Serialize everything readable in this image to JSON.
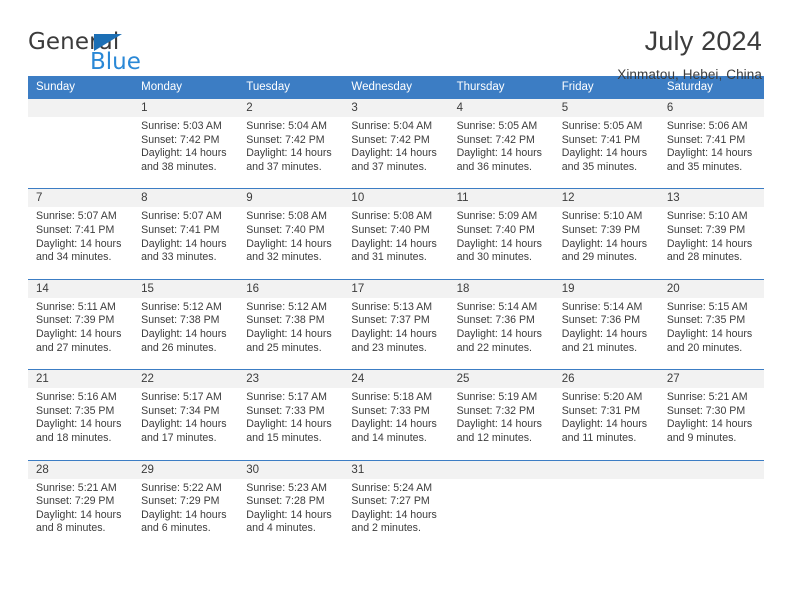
{
  "brand": {
    "name_part1": "General",
    "name_part2": "Blue",
    "accent_color": "#2a88d6",
    "triangle_color": "#1c6fb5"
  },
  "header": {
    "month_title": "July 2024",
    "location": "Xinmatou, Hebei, China"
  },
  "calendar": {
    "header_bg": "#3c7dc4",
    "daynum_bg": "#f2f2f2",
    "weekday_headers": [
      "Sunday",
      "Monday",
      "Tuesday",
      "Wednesday",
      "Thursday",
      "Friday",
      "Saturday"
    ],
    "weeks": [
      [
        {
          "day": "",
          "sunrise": "",
          "sunset": "",
          "daylight1": "",
          "daylight2": ""
        },
        {
          "day": "1",
          "sunrise": "Sunrise: 5:03 AM",
          "sunset": "Sunset: 7:42 PM",
          "daylight1": "Daylight: 14 hours",
          "daylight2": "and 38 minutes."
        },
        {
          "day": "2",
          "sunrise": "Sunrise: 5:04 AM",
          "sunset": "Sunset: 7:42 PM",
          "daylight1": "Daylight: 14 hours",
          "daylight2": "and 37 minutes."
        },
        {
          "day": "3",
          "sunrise": "Sunrise: 5:04 AM",
          "sunset": "Sunset: 7:42 PM",
          "daylight1": "Daylight: 14 hours",
          "daylight2": "and 37 minutes."
        },
        {
          "day": "4",
          "sunrise": "Sunrise: 5:05 AM",
          "sunset": "Sunset: 7:42 PM",
          "daylight1": "Daylight: 14 hours",
          "daylight2": "and 36 minutes."
        },
        {
          "day": "5",
          "sunrise": "Sunrise: 5:05 AM",
          "sunset": "Sunset: 7:41 PM",
          "daylight1": "Daylight: 14 hours",
          "daylight2": "and 35 minutes."
        },
        {
          "day": "6",
          "sunrise": "Sunrise: 5:06 AM",
          "sunset": "Sunset: 7:41 PM",
          "daylight1": "Daylight: 14 hours",
          "daylight2": "and 35 minutes."
        }
      ],
      [
        {
          "day": "7",
          "sunrise": "Sunrise: 5:07 AM",
          "sunset": "Sunset: 7:41 PM",
          "daylight1": "Daylight: 14 hours",
          "daylight2": "and 34 minutes."
        },
        {
          "day": "8",
          "sunrise": "Sunrise: 5:07 AM",
          "sunset": "Sunset: 7:41 PM",
          "daylight1": "Daylight: 14 hours",
          "daylight2": "and 33 minutes."
        },
        {
          "day": "9",
          "sunrise": "Sunrise: 5:08 AM",
          "sunset": "Sunset: 7:40 PM",
          "daylight1": "Daylight: 14 hours",
          "daylight2": "and 32 minutes."
        },
        {
          "day": "10",
          "sunrise": "Sunrise: 5:08 AM",
          "sunset": "Sunset: 7:40 PM",
          "daylight1": "Daylight: 14 hours",
          "daylight2": "and 31 minutes."
        },
        {
          "day": "11",
          "sunrise": "Sunrise: 5:09 AM",
          "sunset": "Sunset: 7:40 PM",
          "daylight1": "Daylight: 14 hours",
          "daylight2": "and 30 minutes."
        },
        {
          "day": "12",
          "sunrise": "Sunrise: 5:10 AM",
          "sunset": "Sunset: 7:39 PM",
          "daylight1": "Daylight: 14 hours",
          "daylight2": "and 29 minutes."
        },
        {
          "day": "13",
          "sunrise": "Sunrise: 5:10 AM",
          "sunset": "Sunset: 7:39 PM",
          "daylight1": "Daylight: 14 hours",
          "daylight2": "and 28 minutes."
        }
      ],
      [
        {
          "day": "14",
          "sunrise": "Sunrise: 5:11 AM",
          "sunset": "Sunset: 7:39 PM",
          "daylight1": "Daylight: 14 hours",
          "daylight2": "and 27 minutes."
        },
        {
          "day": "15",
          "sunrise": "Sunrise: 5:12 AM",
          "sunset": "Sunset: 7:38 PM",
          "daylight1": "Daylight: 14 hours",
          "daylight2": "and 26 minutes."
        },
        {
          "day": "16",
          "sunrise": "Sunrise: 5:12 AM",
          "sunset": "Sunset: 7:38 PM",
          "daylight1": "Daylight: 14 hours",
          "daylight2": "and 25 minutes."
        },
        {
          "day": "17",
          "sunrise": "Sunrise: 5:13 AM",
          "sunset": "Sunset: 7:37 PM",
          "daylight1": "Daylight: 14 hours",
          "daylight2": "and 23 minutes."
        },
        {
          "day": "18",
          "sunrise": "Sunrise: 5:14 AM",
          "sunset": "Sunset: 7:36 PM",
          "daylight1": "Daylight: 14 hours",
          "daylight2": "and 22 minutes."
        },
        {
          "day": "19",
          "sunrise": "Sunrise: 5:14 AM",
          "sunset": "Sunset: 7:36 PM",
          "daylight1": "Daylight: 14 hours",
          "daylight2": "and 21 minutes."
        },
        {
          "day": "20",
          "sunrise": "Sunrise: 5:15 AM",
          "sunset": "Sunset: 7:35 PM",
          "daylight1": "Daylight: 14 hours",
          "daylight2": "and 20 minutes."
        }
      ],
      [
        {
          "day": "21",
          "sunrise": "Sunrise: 5:16 AM",
          "sunset": "Sunset: 7:35 PM",
          "daylight1": "Daylight: 14 hours",
          "daylight2": "and 18 minutes."
        },
        {
          "day": "22",
          "sunrise": "Sunrise: 5:17 AM",
          "sunset": "Sunset: 7:34 PM",
          "daylight1": "Daylight: 14 hours",
          "daylight2": "and 17 minutes."
        },
        {
          "day": "23",
          "sunrise": "Sunrise: 5:17 AM",
          "sunset": "Sunset: 7:33 PM",
          "daylight1": "Daylight: 14 hours",
          "daylight2": "and 15 minutes."
        },
        {
          "day": "24",
          "sunrise": "Sunrise: 5:18 AM",
          "sunset": "Sunset: 7:33 PM",
          "daylight1": "Daylight: 14 hours",
          "daylight2": "and 14 minutes."
        },
        {
          "day": "25",
          "sunrise": "Sunrise: 5:19 AM",
          "sunset": "Sunset: 7:32 PM",
          "daylight1": "Daylight: 14 hours",
          "daylight2": "and 12 minutes."
        },
        {
          "day": "26",
          "sunrise": "Sunrise: 5:20 AM",
          "sunset": "Sunset: 7:31 PM",
          "daylight1": "Daylight: 14 hours",
          "daylight2": "and 11 minutes."
        },
        {
          "day": "27",
          "sunrise": "Sunrise: 5:21 AM",
          "sunset": "Sunset: 7:30 PM",
          "daylight1": "Daylight: 14 hours",
          "daylight2": "and 9 minutes."
        }
      ],
      [
        {
          "day": "28",
          "sunrise": "Sunrise: 5:21 AM",
          "sunset": "Sunset: 7:29 PM",
          "daylight1": "Daylight: 14 hours",
          "daylight2": "and 8 minutes."
        },
        {
          "day": "29",
          "sunrise": "Sunrise: 5:22 AM",
          "sunset": "Sunset: 7:29 PM",
          "daylight1": "Daylight: 14 hours",
          "daylight2": "and 6 minutes."
        },
        {
          "day": "30",
          "sunrise": "Sunrise: 5:23 AM",
          "sunset": "Sunset: 7:28 PM",
          "daylight1": "Daylight: 14 hours",
          "daylight2": "and 4 minutes."
        },
        {
          "day": "31",
          "sunrise": "Sunrise: 5:24 AM",
          "sunset": "Sunset: 7:27 PM",
          "daylight1": "Daylight: 14 hours",
          "daylight2": "and 2 minutes."
        },
        {
          "day": "",
          "sunrise": "",
          "sunset": "",
          "daylight1": "",
          "daylight2": ""
        },
        {
          "day": "",
          "sunrise": "",
          "sunset": "",
          "daylight1": "",
          "daylight2": ""
        },
        {
          "day": "",
          "sunrise": "",
          "sunset": "",
          "daylight1": "",
          "daylight2": ""
        }
      ]
    ]
  }
}
